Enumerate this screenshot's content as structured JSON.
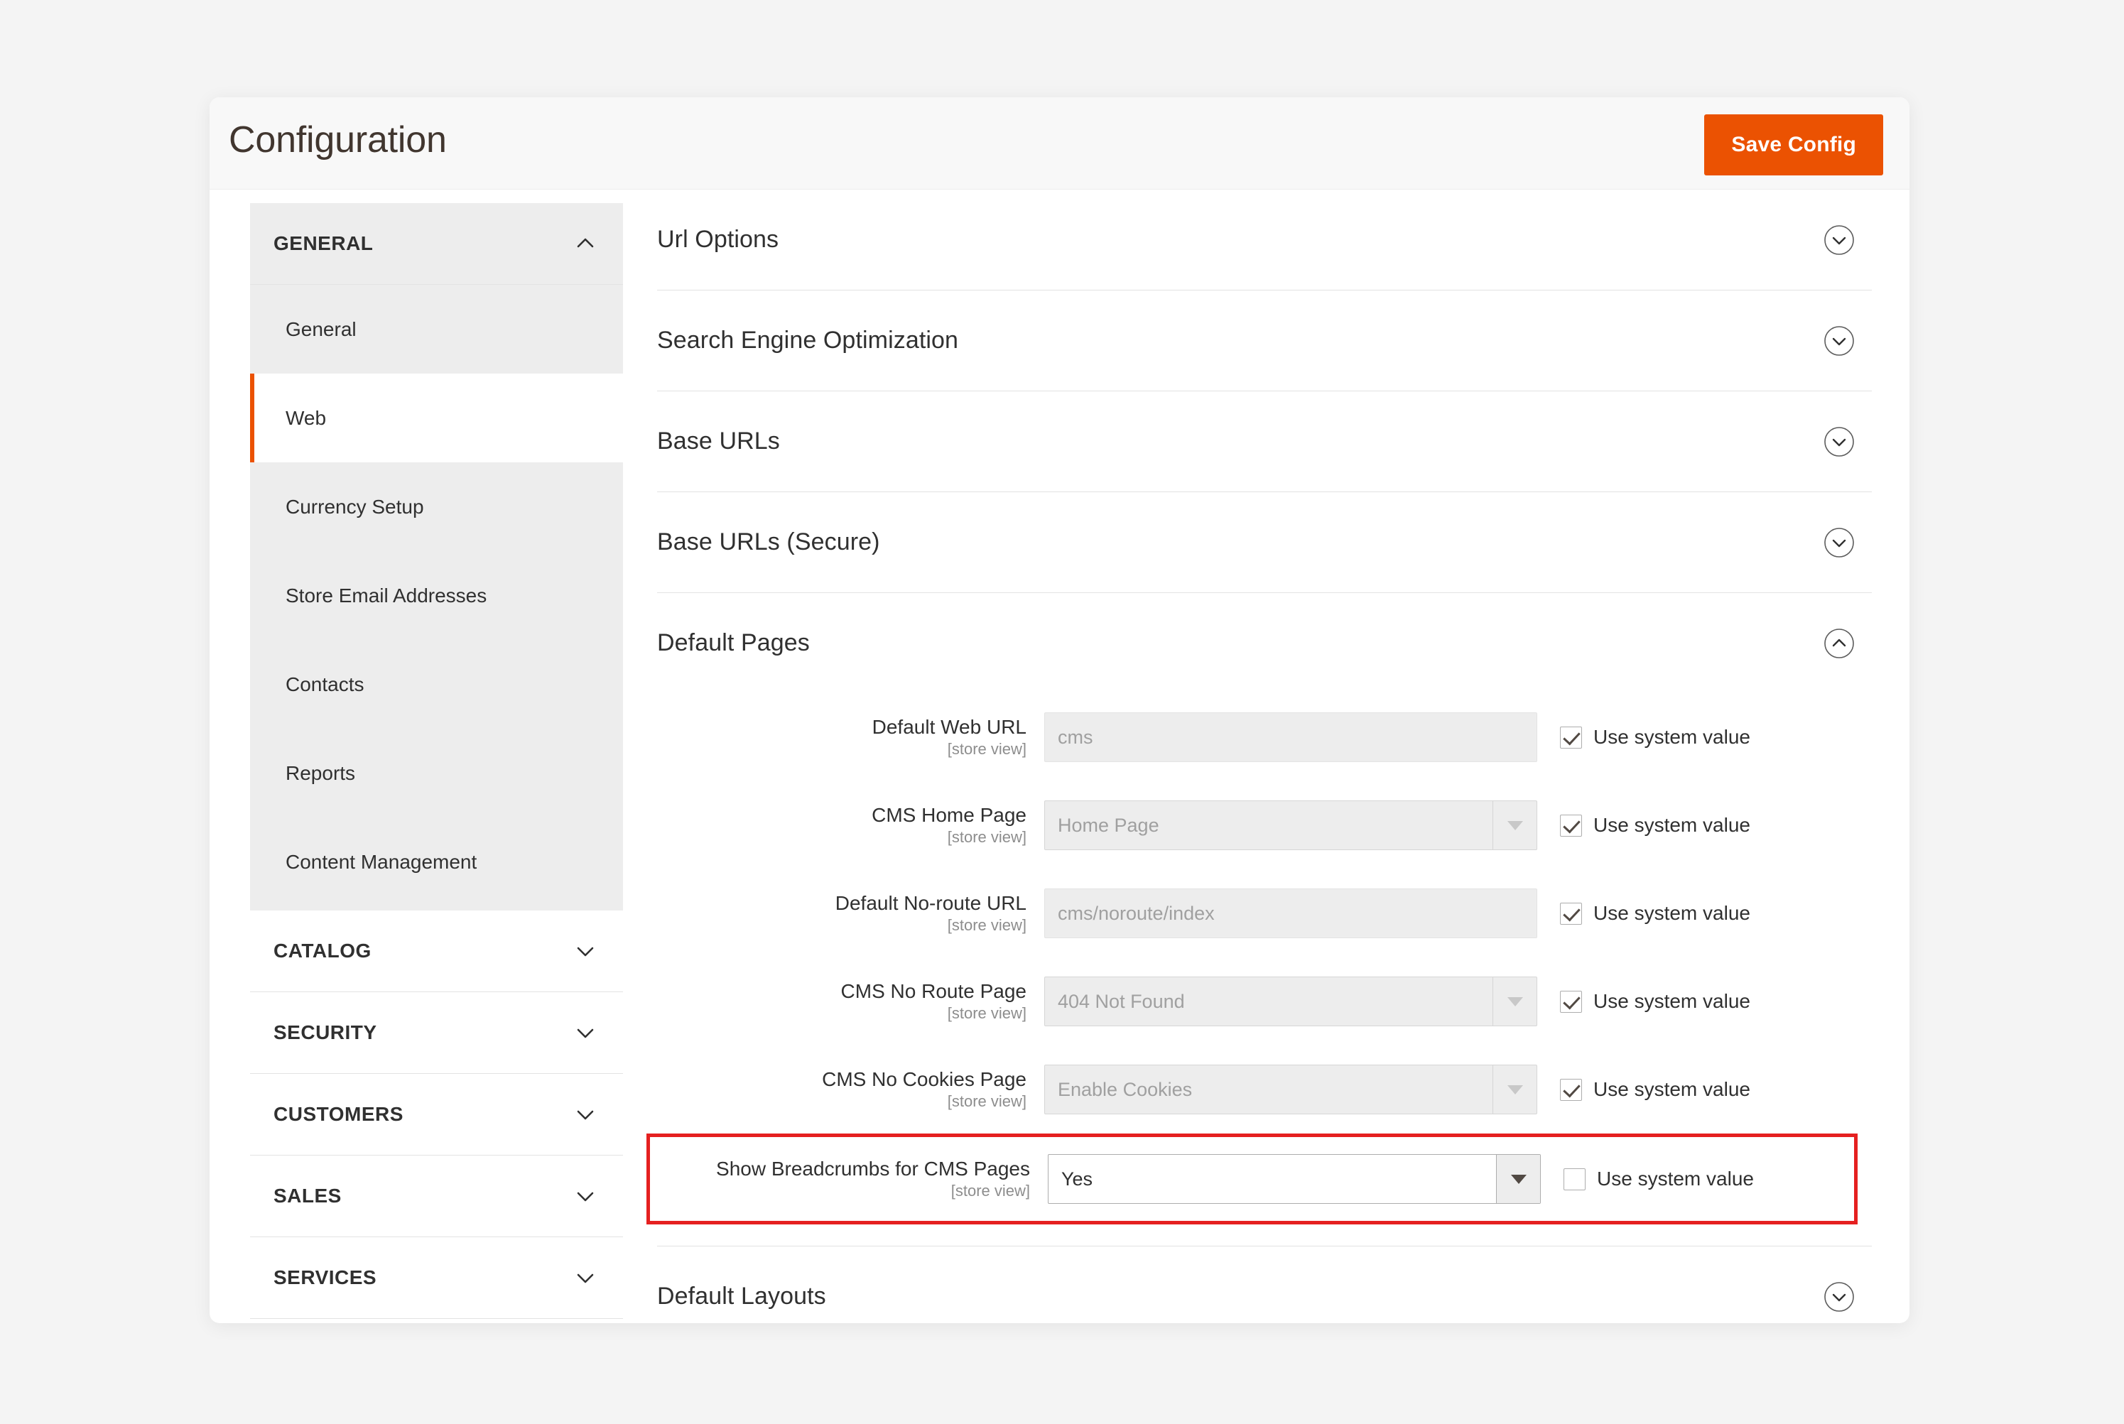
{
  "header": {
    "title": "Configuration",
    "save_label": "Save Config"
  },
  "sidebar": {
    "sections": [
      {
        "label": "GENERAL",
        "expanded": true,
        "icon": "chevron-up-icon",
        "items": [
          {
            "label": "General",
            "active": false
          },
          {
            "label": "Web",
            "active": true
          },
          {
            "label": "Currency Setup",
            "active": false
          },
          {
            "label": "Store Email Addresses",
            "active": false
          },
          {
            "label": "Contacts",
            "active": false
          },
          {
            "label": "Reports",
            "active": false
          },
          {
            "label": "Content Management",
            "active": false
          }
        ]
      },
      {
        "label": "CATALOG",
        "expanded": false,
        "icon": "chevron-down-icon",
        "items": []
      },
      {
        "label": "SECURITY",
        "expanded": false,
        "icon": "chevron-down-icon",
        "items": []
      },
      {
        "label": "CUSTOMERS",
        "expanded": false,
        "icon": "chevron-down-icon",
        "items": []
      },
      {
        "label": "SALES",
        "expanded": false,
        "icon": "chevron-down-icon",
        "items": []
      },
      {
        "label": "SERVICES",
        "expanded": false,
        "icon": "chevron-down-icon",
        "items": []
      }
    ]
  },
  "main": {
    "sections": [
      {
        "title": "Url Options",
        "expanded": false,
        "toggle_icon": "circle-chevron-down-icon"
      },
      {
        "title": "Search Engine Optimization",
        "expanded": false,
        "toggle_icon": "circle-chevron-down-icon"
      },
      {
        "title": "Base URLs",
        "expanded": false,
        "toggle_icon": "circle-chevron-down-icon"
      },
      {
        "title": "Base URLs (Secure)",
        "expanded": false,
        "toggle_icon": "circle-chevron-down-icon"
      },
      {
        "title": "Default Pages",
        "expanded": true,
        "toggle_icon": "circle-chevron-up-icon"
      },
      {
        "title": "Default Layouts",
        "expanded": false,
        "toggle_icon": "circle-chevron-down-icon"
      }
    ],
    "default_pages_fields": [
      {
        "label": "Default Web URL",
        "scope": "[store view]",
        "control": "text",
        "value": "cms",
        "disabled": true,
        "use_system": {
          "label": "Use system value",
          "checked": true
        },
        "highlighted": false
      },
      {
        "label": "CMS Home Page",
        "scope": "[store view]",
        "control": "select",
        "value": "Home Page",
        "disabled": true,
        "use_system": {
          "label": "Use system value",
          "checked": true
        },
        "highlighted": false
      },
      {
        "label": "Default No-route URL",
        "scope": "[store view]",
        "control": "text",
        "value": "cms/noroute/index",
        "disabled": true,
        "use_system": {
          "label": "Use system value",
          "checked": true
        },
        "highlighted": false
      },
      {
        "label": "CMS No Route Page",
        "scope": "[store view]",
        "control": "select",
        "value": "404 Not Found",
        "disabled": true,
        "use_system": {
          "label": "Use system value",
          "checked": true
        },
        "highlighted": false
      },
      {
        "label": "CMS No Cookies Page",
        "scope": "[store view]",
        "control": "select",
        "value": "Enable Cookies",
        "disabled": true,
        "use_system": {
          "label": "Use system value",
          "checked": true
        },
        "highlighted": false
      },
      {
        "label": "Show Breadcrumbs for CMS Pages",
        "scope": "[store view]",
        "control": "select",
        "value": "Yes",
        "disabled": false,
        "use_system": {
          "label": "Use system value",
          "checked": false
        },
        "highlighted": true
      }
    ]
  },
  "colors": {
    "accent": "#eb5202",
    "highlight": "#e52020",
    "text": "#303030",
    "muted": "#8d8d8d",
    "panel": "#ededed"
  }
}
